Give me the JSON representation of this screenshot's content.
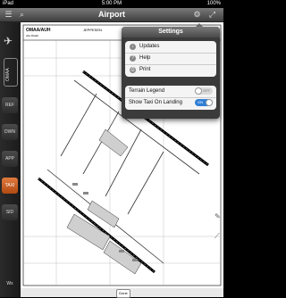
{
  "status": {
    "carrier": "iPad",
    "time": "5:00 PM",
    "battery": "100%"
  },
  "nav": {
    "title": "Airport"
  },
  "sidebar": {
    "tabs": [
      {
        "label": "OMAA"
      },
      {
        "label": "REF"
      },
      {
        "label": "DWN"
      },
      {
        "label": "APP"
      },
      {
        "label": "TAXI",
        "active": true
      },
      {
        "label": "SID"
      }
    ],
    "bottom_label": "Wx"
  },
  "chart": {
    "airport_code": "OMAA/AUH",
    "city": "Abu Dhabi",
    "name": "ABU DHABI INTL",
    "publisher": "JEPPESEN"
  },
  "settings": {
    "title": "Settings",
    "items": [
      {
        "label": "Updates",
        "icon": "download-icon"
      },
      {
        "label": "Help",
        "icon": "help-icon"
      },
      {
        "label": "Print",
        "icon": "print-icon"
      }
    ],
    "toggles": [
      {
        "label": "Terrain Legend",
        "state": "OFF"
      },
      {
        "label": "Show Taxi On Landing",
        "state": "ON"
      }
    ]
  },
  "bottom": {
    "done_label": "Done"
  }
}
